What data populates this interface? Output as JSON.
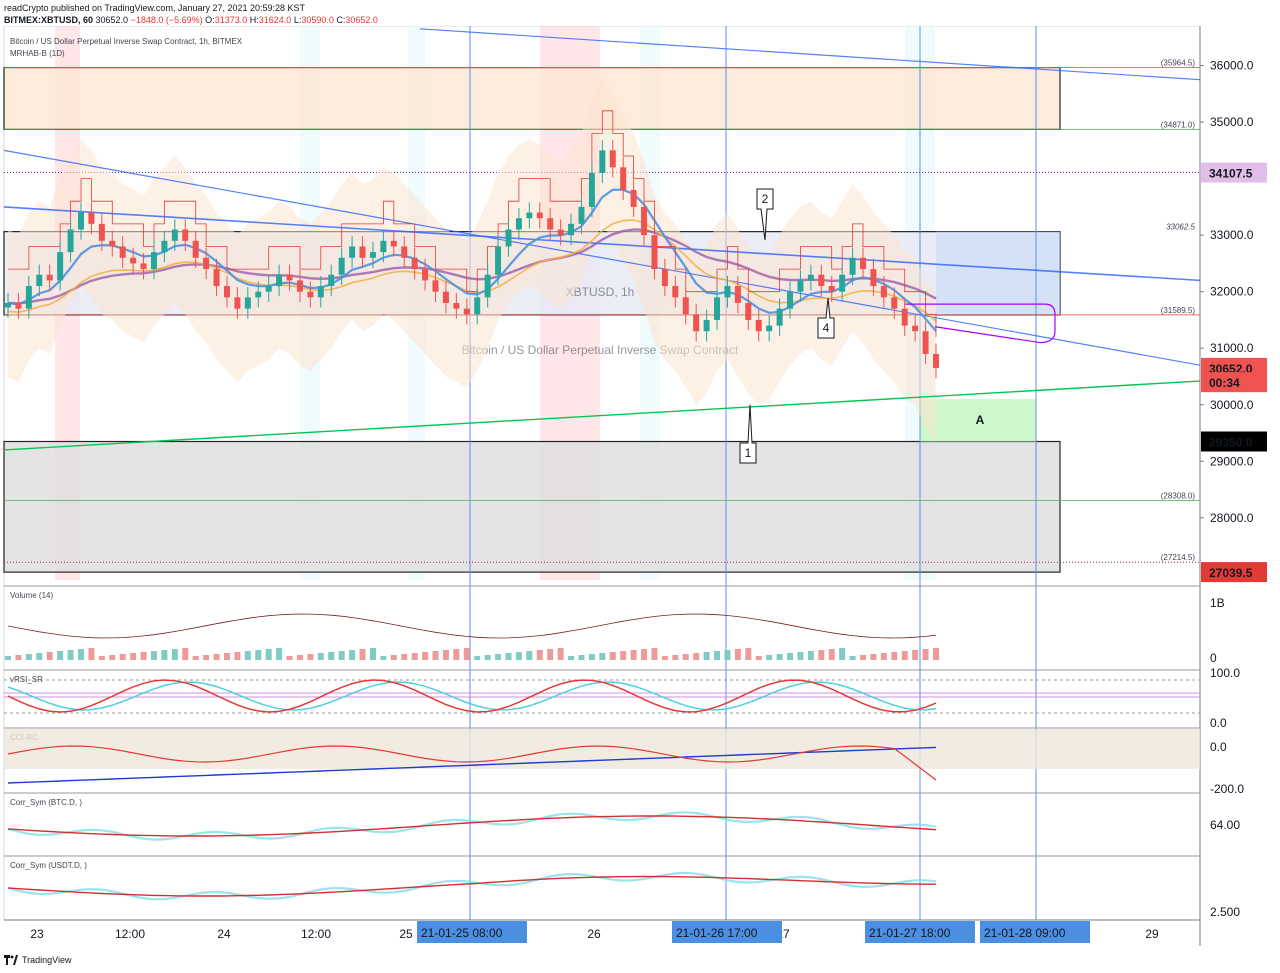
{
  "header": {
    "published_line": "readCrypto published on TradingView.com, January 27, 2021 20:59:28 KST",
    "symbol": "BITMEX:XBTUSD, 60",
    "last": "30652.0",
    "change": "−1848.0 (−5.69%)",
    "ohlc_o_label": "O:",
    "ohlc_o": "31373.0",
    "ohlc_h_label": "H:",
    "ohlc_h": "31624.0",
    "ohlc_l_label": "L:",
    "ohlc_l": "30590.0",
    "ohlc_c_label": "C:",
    "ohlc_c": "30652.0"
  },
  "chart_title": "Bitcoin / US Dollar Perpetual Inverse Swap Contract, 1h, BITMEX",
  "indicator_label": "MRHAB-B (1D)",
  "watermark_symbol": "XBTUSD, 1h",
  "watermark_name": "Bitcoin / US Dollar Perpetual Inverse Swap Contract",
  "footer_brand": "TradingView",
  "colors": {
    "up": "#26a69a",
    "down": "#ef5350",
    "trend_blue": "#2962ff",
    "green_line": "#00c853",
    "purple": "#9c27b0",
    "orange": "#ff9800"
  },
  "chart_data": {
    "type": "candlestick",
    "title": "Bitcoin / US Dollar Perpetual Inverse Swap Contract, 1h, BITMEX",
    "x_ticks": [
      "23",
      "12:00",
      "24",
      "12:00",
      "25",
      "26",
      "27",
      "29"
    ],
    "x_highlight_labels": [
      "21-01-25   08:00",
      "21-01-26   17:00",
      "21-01-27   18:00",
      "21-01-28   09:00"
    ],
    "ylim": [
      26900,
      36700
    ],
    "y_ticks": [
      28000,
      29000,
      30000,
      31000,
      32000,
      33000,
      34000,
      35000,
      36000
    ],
    "y_tick_labels": [
      "28000.0",
      "29000.0",
      "30000.0",
      "31000.0",
      "32000.0",
      "33000.0",
      "35000.0",
      "36000.0"
    ],
    "price_badges": [
      {
        "value": 34107.5,
        "label": "34107.5",
        "color": "#e1bee7",
        "text_color": "#4a148c"
      },
      {
        "value": 30652.0,
        "label": "30652.0",
        "color": "#ef5350",
        "text_color": "#ffffff"
      },
      {
        "value": 30400.0,
        "label": "00:34",
        "color": "#ef5350",
        "text_color": "#ffffff"
      },
      {
        "value": 29350.0,
        "label": "29350.0",
        "color": "#000000",
        "text_color": "#ffffff"
      },
      {
        "value": 27039.5,
        "label": "27039.5",
        "color": "#e53935",
        "text_color": "#ffffff"
      }
    ],
    "levels": [
      {
        "value": 35964.5,
        "label": "(35964.5)"
      },
      {
        "value": 34871.0,
        "label": "(34871.0)"
      },
      {
        "value": 33062.5,
        "label": "33062.5"
      },
      {
        "value": 31589.5,
        "label": "(31589.5)"
      },
      {
        "value": 28308.0,
        "label": "(28308.0)"
      },
      {
        "value": 27214.5,
        "label": "(27214.5)"
      }
    ],
    "annotations": [
      {
        "label": "1"
      },
      {
        "label": "2"
      },
      {
        "label": "4"
      },
      {
        "label": "A"
      }
    ],
    "series_close": [
      31800,
      31700,
      32100,
      32300,
      32200,
      32700,
      33100,
      33400,
      33200,
      32900,
      32800,
      32600,
      32500,
      32400,
      32700,
      32900,
      33100,
      32900,
      32600,
      32400,
      32100,
      31900,
      31700,
      31900,
      32000,
      32100,
      32300,
      32200,
      32000,
      31900,
      32100,
      32300,
      32600,
      32800,
      32600,
      32700,
      32900,
      32800,
      32600,
      32400,
      32200,
      32000,
      31800,
      31700,
      31600,
      31900,
      32300,
      32800,
      33100,
      33300,
      33400,
      33300,
      33100,
      33000,
      33200,
      33500,
      34100,
      34500,
      34200,
      33800,
      33500,
      33000,
      32400,
      32100,
      31900,
      31600,
      31300,
      31500,
      31900,
      32100,
      31800,
      31500,
      31300,
      31400,
      31700,
      32000,
      32200,
      32300,
      32100,
      32000,
      32300,
      32600,
      32400,
      32100,
      31900,
      31700,
      31400,
      31300,
      30900,
      30652
    ],
    "panes": [
      {
        "name": "Volume (14)",
        "y_labels": [
          "1B",
          "0"
        ]
      },
      {
        "name": "vRSI_SR",
        "y_labels": [
          "100.0",
          "0.0"
        ]
      },
      {
        "name": "CCI-RC",
        "y_labels": [
          "0.0",
          "-200.0"
        ]
      },
      {
        "name": "Corr_Sym (BTC.D, )",
        "y_labels": [
          "64.00"
        ]
      },
      {
        "name": "Corr_Sym (USDT.D, )",
        "y_labels": [
          "2.500"
        ]
      }
    ]
  }
}
